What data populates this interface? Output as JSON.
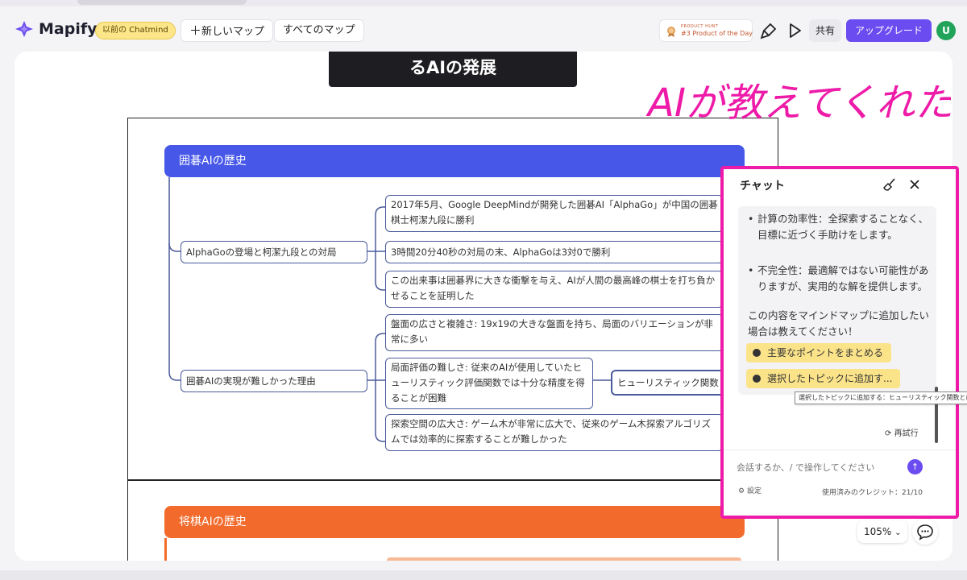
{
  "app": {
    "name": "Mapify",
    "previous_chip": "以前の Chatmind",
    "new_map_label": "新しいマップ",
    "all_maps_label": "すべてのマップ",
    "product_hunt_small": "PRODUCT HUNT",
    "product_hunt_big": "#3 Product of the Day",
    "share_label": "共有",
    "upgrade_label": "アップグレード",
    "avatar_initial": "U",
    "accent_color": "#6b4cf0"
  },
  "mindmap": {
    "title_fragment": "るAIの発展",
    "sections": [
      {
        "title": "囲碁AIの歴史",
        "color": "#4758e8",
        "branches": [
          {
            "label": "AlphaGoの登場と柯潔九段との対局",
            "children": [
              "2017年5月、Google DeepMindが開発した囲碁AI「AlphaGo」が中国の囲碁棋士柯潔九段に勝利",
              "3時間20分40秒の対局の末、AlphaGoは3対0で勝利",
              "この出来事は囲碁界に大きな衝撃を与え、AIが人間の最高峰の棋士を打ち負かせることを証明した"
            ]
          },
          {
            "label": "囲碁AIの実現が難しかった理由",
            "children": [
              "盤面の広さと複雑さ: 19x19の大きな盤面を持ち、局面のバリエーションが非常に多い",
              "局面評価の難しさ: 従来のAIが使用していたヒューリスティック評価関数では十分な精度を得ることが困難",
              "探索空間の広大さ: ゲーム木が非常に広大で、従来のゲーム木探索アルゴリズムでは効率的に探索することが難しかった"
            ],
            "sub_child": "ヒューリスティック関数"
          }
        ]
      },
      {
        "title": "将棋AIの歴史",
        "color": "#f26b2d"
      }
    ]
  },
  "annotation": {
    "text": "AIが教えてくれた",
    "color": "#ee1aa8"
  },
  "chat": {
    "title": "チャット",
    "bullets": [
      "計算の効率性：全探索することなく、目標に近づく手助けをします。",
      "不完全性：最適解ではない可能性がありますが、実用的な解を提供します。"
    ],
    "message": "この内容をマインドマップに追加したい場合は教えてください！",
    "suggestions": [
      "主要なポイントをまとめる",
      "選択したトピックに追加す..."
    ],
    "tooltip": "選択したトピックに追加する：ヒューリスティック関数とは",
    "retry_label": "再試行",
    "input_placeholder": "会話するか、/ で操作してください",
    "settings_label": "設定",
    "credits_label": "使用済みのクレジット：21/10"
  },
  "controls": {
    "zoom_label": "105%"
  }
}
